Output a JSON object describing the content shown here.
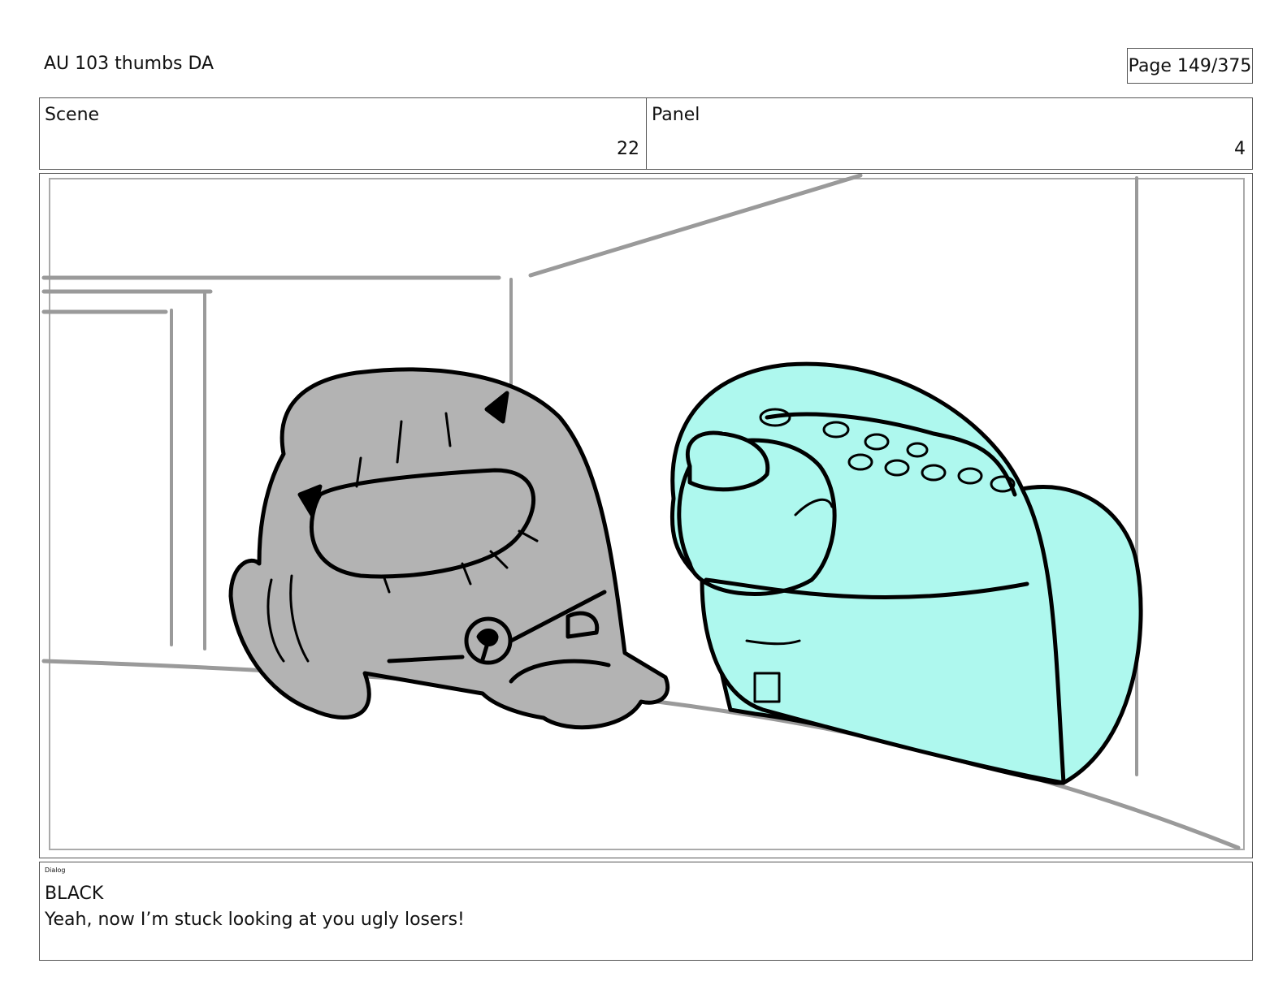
{
  "header": {
    "title": "AU 103 thumbs DA",
    "page": "Page 149/375"
  },
  "info": {
    "scene_label": "Scene",
    "scene_value": "22",
    "panel_label": "Panel",
    "panel_value": "4"
  },
  "dialog": {
    "label": "Dialog",
    "speaker": "BLACK",
    "line": "Yeah, now I’m stuck looking at you ugly losers!"
  },
  "colors": {
    "black_character": "#b3b3b3",
    "cyan_character": "#aef8ee",
    "background_lines": "#9a9a9a",
    "outline": "#000000"
  }
}
